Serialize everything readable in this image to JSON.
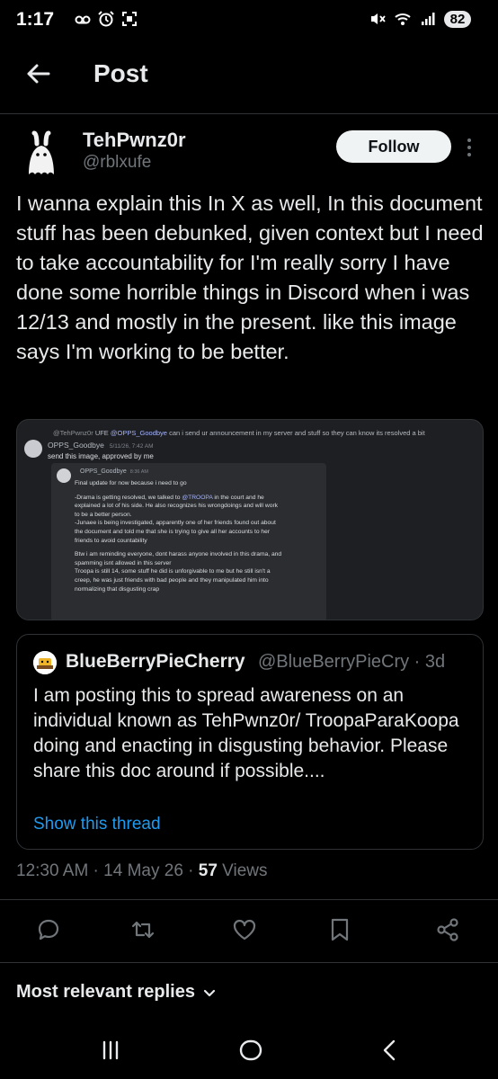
{
  "status": {
    "time": "1:17",
    "battery": "82"
  },
  "header": {
    "title": "Post"
  },
  "post": {
    "display_name": "TehPwnz0r",
    "handle": "@rblxufe",
    "follow_label": "Follow",
    "text": "I wanna explain this In X as well, In this document stuff has been debunked, given context but I need to take accountability for I'm really sorry I have done some horrible things in Discord when i was 12/13 and mostly in the present. like this image says I'm working to be better.",
    "timestamp": "12:30 AM · 14 May 26 · ",
    "views_count": "57",
    "views_label": " Views"
  },
  "media": {
    "reply_user": "@TehPwnz0r",
    "reply_tag": "UFE",
    "reply_mention": "@OPPS_Goodbye",
    "reply_text": " can i send ur announcement in my server and stuff so they can know its resolved a bit",
    "user": "OPPS_Goodbye",
    "user_time": "5/11/26, 7:42 AM",
    "body": "send this image, approved by me",
    "inner_user": "OPPS_Goodbye",
    "inner_time": "8:36 AM",
    "inner_lines": [
      "Final update for now because i need to go",
      "",
      "-Drama is getting resolved, we talked to @TROOPA in the court and he",
      "explained a lot of his side. He also recognizes his wrongdoings and will work",
      "to be a better person.",
      "-Junaee is being investigated, apparently one of her friends found out about",
      "the document and told me that she is trying to give all her accounts to her",
      "friends to avoid countability",
      "",
      "Btw i am reminding everyone, dont harass anyone involved in this drama, and",
      "spamming isnt allowed in this server",
      "Troopa is still 14, some stuff he did is unforgivable to me but he still isn't a",
      "creep, he was just friends with bad people and they manipulated him into",
      "normalizing that disgusting crap"
    ]
  },
  "quote": {
    "display_name": "BlueBerryPieCherry",
    "handle": "@BlueBerryPieCry · 3d",
    "text": "I am posting this to spread awareness on an individual known as TehPwnz0r/ TroopaParaKoopa doing and enacting in disgusting behavior. Please share this doc around if possible....",
    "show_thread": "Show this thread"
  },
  "actions": [
    "reply-icon",
    "repost-icon",
    "like-icon",
    "bookmark-icon",
    "share-icon"
  ],
  "replies_sort": "Most relevant replies",
  "colors": {
    "link": "#1d9bf0",
    "muted": "#71767b",
    "text": "#e7e9ea",
    "background": "#000000"
  }
}
